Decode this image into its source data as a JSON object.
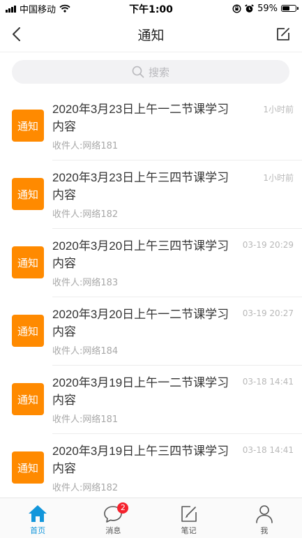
{
  "status_bar": {
    "carrier": "中国移动",
    "time": "下午1:00",
    "battery": "59%",
    "battery_level": 0.59
  },
  "nav": {
    "title": "通知"
  },
  "search": {
    "placeholder": "搜索"
  },
  "notices": [
    {
      "badge": "通知",
      "title": "2020年3月23日上午一二节课学习内容",
      "time": "1小时前",
      "recipient": "收件人:网络181"
    },
    {
      "badge": "通知",
      "title": "2020年3月23日上午三四节课学习内容",
      "time": "1小时前",
      "recipient": "收件人:网络182"
    },
    {
      "badge": "通知",
      "title": "2020年3月20日上午三四节课学习内容",
      "time": "03-19 20:29",
      "recipient": "收件人:网络183"
    },
    {
      "badge": "通知",
      "title": "2020年3月20日上午一二节课学习内容",
      "time": "03-19 20:27",
      "recipient": "收件人:网络184"
    },
    {
      "badge": "通知",
      "title": "2020年3月19日上午一二节课学习内容",
      "time": "03-18 14:41",
      "recipient": "收件人:网络181"
    },
    {
      "badge": "通知",
      "title": "2020年3月19日上午三四节课学习内容",
      "time": "03-18 14:41",
      "recipient": "收件人:网络182"
    }
  ],
  "tab_bar": {
    "home": "首页",
    "messages": "消息",
    "messages_badge": "2",
    "notes": "笔记",
    "me": "我"
  },
  "colors": {
    "badge": "#ff8a00",
    "accent": "#1296db",
    "unread": "#f5222d"
  }
}
